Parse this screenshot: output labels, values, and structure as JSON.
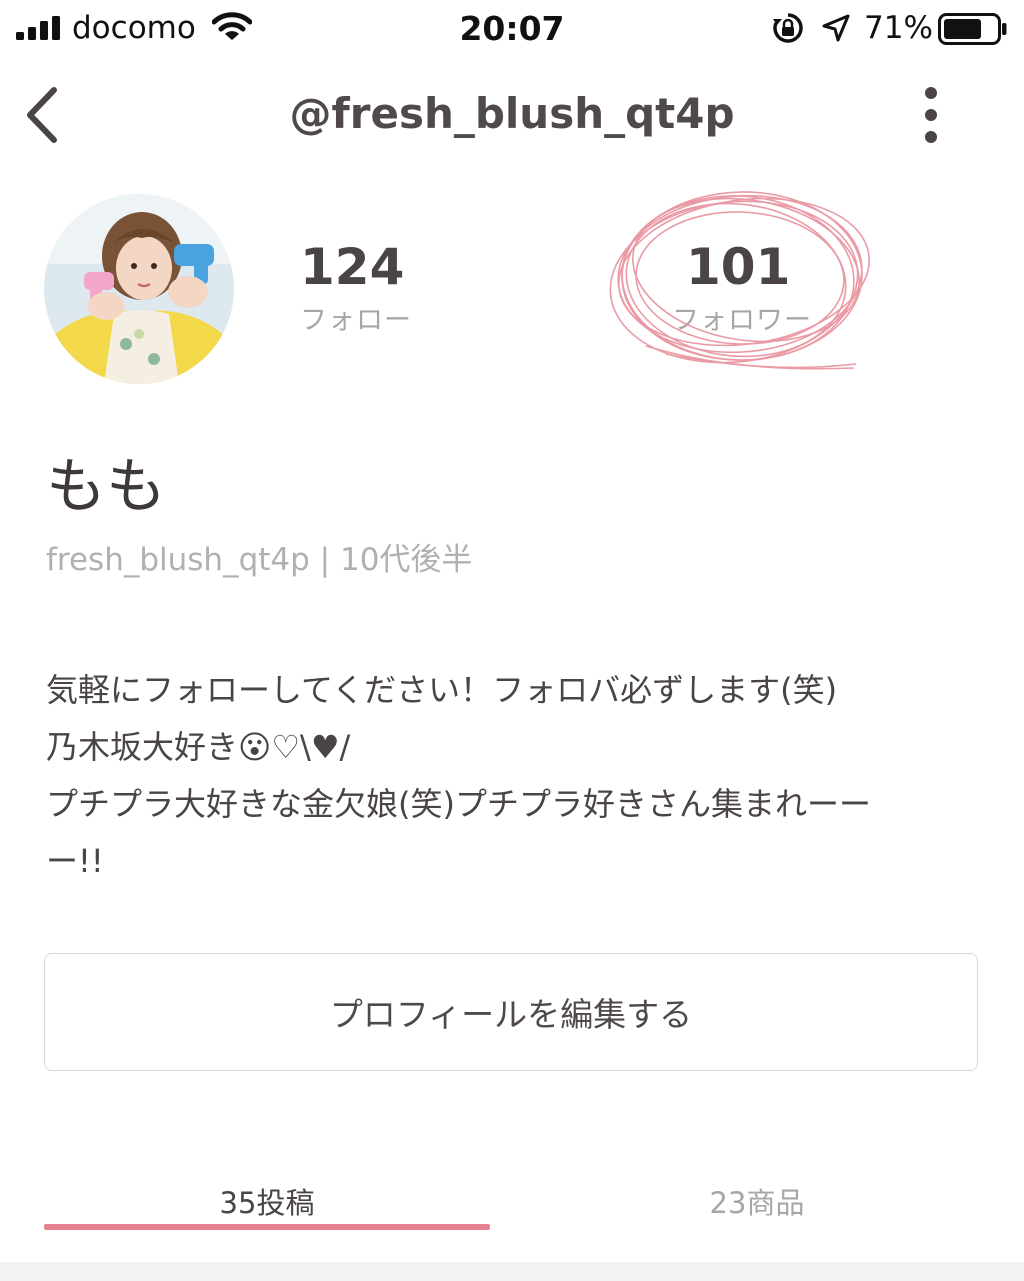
{
  "status_bar": {
    "carrier": "docomo",
    "time": "20:07",
    "battery_percent": "71%",
    "battery_level": 0.71,
    "icons": [
      "signal-icon",
      "wifi-icon",
      "rotation-lock-icon",
      "location-arrow-icon",
      "battery-icon"
    ]
  },
  "header": {
    "title": "@fresh_blush_qt4p",
    "back_icon": "chevron-left-icon",
    "menu_icon": "vertical-dots-icon"
  },
  "profile": {
    "following_count": "124",
    "following_label": "フォロー",
    "followers_count": "101",
    "followers_label": "フォロワー",
    "display_name": "もも",
    "username_line": "fresh_blush_qt4p | 10代後半",
    "bio_lines": [
      "気軽にフォローしてください！フォロバ必ずします(笑)",
      "乃木坂大好き😮♡\\♥/",
      "プチプラ大好きな金欠娘(笑)プチプラ好きさん集まれーー",
      "ー!!"
    ],
    "edit_button": "プロフィールを編集する"
  },
  "tabs": [
    {
      "label": "35投稿",
      "active": true
    },
    {
      "label": "23商品",
      "active": false
    }
  ],
  "colors": {
    "accent": "#e7828f",
    "scribble": "#e8909c",
    "text": "#4a4444",
    "muted": "#aaa6a6"
  }
}
